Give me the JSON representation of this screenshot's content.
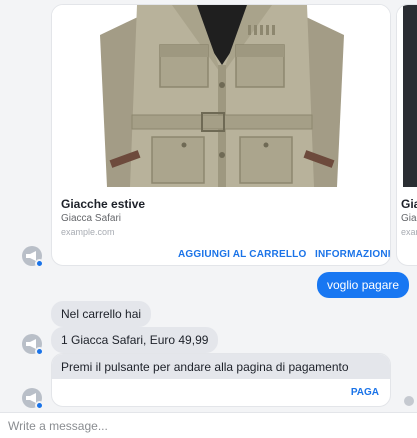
{
  "carousel": {
    "cards": [
      {
        "title": "Giacche estive",
        "subtitle": "Giacca Safari",
        "source": "example.com",
        "buttons": {
          "add": "AGGIUNGI AL CARRELLO",
          "info": "INFORMAZIONI"
        },
        "image_icon": "safari-jacket-photo"
      },
      {
        "title": "Giac",
        "subtitle": "Giac",
        "source": "exar"
      }
    ]
  },
  "messages": {
    "user_1": "voglio pagare",
    "bot_1": "Nel carrello hai",
    "bot_2": "1 Giacca Safari, Euro 49,99",
    "bot_3": "Premi il pulsante per andare alla pagina di pagamento",
    "pay_button": "PAGA"
  },
  "composer": {
    "placeholder": "Write a message..."
  },
  "colors": {
    "accent": "#1a73e8",
    "user_bubble": "#1877f2",
    "bot_bubble": "#e4e6eb",
    "background": "#f3f4f6"
  }
}
